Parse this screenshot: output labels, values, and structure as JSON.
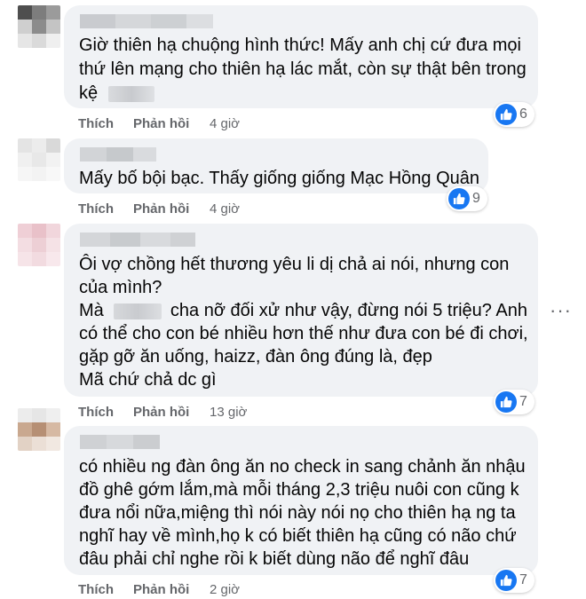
{
  "comments": [
    {
      "lines": [
        {
          "text": "Giờ thiên hạ chuộng hình thức! Mấy anh chị cứ đưa mọi"
        },
        {
          "text": "thứ lên mạng cho thiên hạ lác mắt, còn sự thật bên trong"
        },
        {
          "text": "kệ"
        }
      ],
      "like_label": "Thích",
      "reply_label": "Phản hồi",
      "time": "4 giờ",
      "reaction_count": "6"
    },
    {
      "lines": [
        {
          "text": "Mấy bố bội bạc. Thấy giống giống Mạc Hồng Quân"
        }
      ],
      "like_label": "Thích",
      "reply_label": "Phản hồi",
      "time": "4 giờ",
      "reaction_count": "9"
    },
    {
      "lines": [
        {
          "text": "Ôi vợ chồng hết thương yêu li dị chả ai nói, nhưng con"
        },
        {
          "text": "của mình?"
        },
        {
          "text": "Mà",
          "after": "cha nỡ đối xử như vậy, đừng nói 5 triệu? Anh"
        },
        {
          "text": "có thể cho con bé nhiều hơn thế như đưa con bé đi chơi,"
        },
        {
          "text": "gặp gỡ ăn uống, haizz, đàn ông đúng là, đẹp"
        },
        {
          "text": "Mã chứ chả dc gì"
        }
      ],
      "like_label": "Thích",
      "reply_label": "Phản hồi",
      "time": "13 giờ",
      "reaction_count": "7",
      "more_label": "···"
    },
    {
      "lines": [
        {
          "text": "có nhiều ng đàn ông ăn no check in sang chảnh ăn nhậu"
        },
        {
          "text": "đồ ghê gớm lắm,mà mỗi tháng 2,3 triệu nuôi con cũng k"
        },
        {
          "text": "đưa nổi nữa,miệng thì nói này nói nọ cho thiên hạ ng ta"
        },
        {
          "text": "nghĩ hay về mình,họ k có biết thiên hạ cũng có não chứ"
        },
        {
          "text": "đâu phải chỉ nghe rồi k biết dùng não để nghĩ đâu"
        }
      ],
      "like_label": "Thích",
      "reply_label": "Phản hồi",
      "time": "2 giờ",
      "reaction_count": "7"
    }
  ],
  "colors": {
    "bubble": "#f0f2f5",
    "action_text": "#65676b",
    "like_blue": "#1877f2"
  },
  "icons": {
    "reaction": "like-thumb-icon",
    "more": "more-options-icon"
  }
}
